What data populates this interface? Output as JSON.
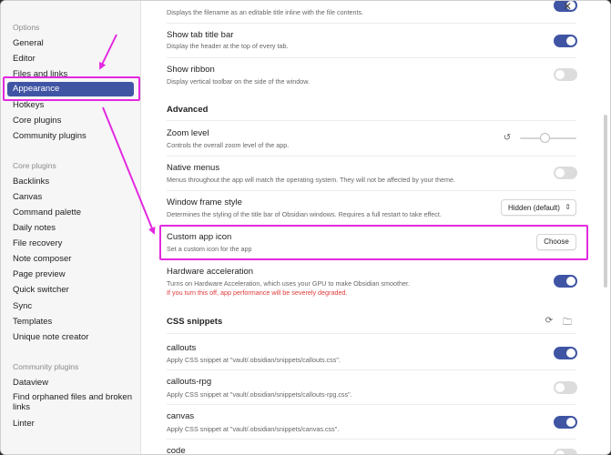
{
  "sidebar": {
    "options_title": "Options",
    "options_items": [
      "General",
      "Editor",
      "Files and links",
      "Appearance",
      "Hotkeys",
      "Core plugins",
      "Community plugins"
    ],
    "core_title": "Core plugins",
    "core_items": [
      "Backlinks",
      "Canvas",
      "Command palette",
      "Daily notes",
      "File recovery",
      "Note composer",
      "Page preview",
      "Quick switcher",
      "Sync",
      "Templates",
      "Unique note creator"
    ],
    "community_title": "Community plugins",
    "community_items": [
      "Dataview",
      "Find orphaned files and broken links",
      "Linter"
    ]
  },
  "settings": {
    "inline_title_desc": "Displays the filename as an editable title inline with the file contents.",
    "tab_title_bar": {
      "name": "Show tab title bar",
      "desc": "Display the header at the top of every tab.",
      "enabled": true
    },
    "ribbon": {
      "name": "Show ribbon",
      "desc": "Display vertical toolbar on the side of the window.",
      "enabled": false
    },
    "advanced_heading": "Advanced",
    "zoom": {
      "name": "Zoom level",
      "desc": "Controls the overall zoom level of the app.",
      "level": 0.45
    },
    "native_menus": {
      "name": "Native menus",
      "desc": "Menus throughout the app will match the operating system. They will not be affected by your theme.",
      "enabled": false
    },
    "frame_style": {
      "name": "Window frame style",
      "desc": "Determines the styling of the title bar of Obsidian windows. Requires a full restart to take effect.",
      "value": "Hidden (default)"
    },
    "app_icon": {
      "name": "Custom app icon",
      "desc": "Set a custom icon for the app",
      "button": "Choose"
    },
    "hw_accel": {
      "name": "Hardware acceleration",
      "desc": "Turns on Hardware Acceleration, which uses your GPU to make Obsidian smoother.",
      "warning": "If you turn this off, app performance will be severely degraded.",
      "enabled": true
    },
    "css_heading": "CSS snippets",
    "snippets": [
      {
        "name": "callouts",
        "desc": "Apply CSS snippet at \"vault/.obsidian/snippets/callouts.css\".",
        "enabled": true
      },
      {
        "name": "callouts-rpg",
        "desc": "Apply CSS snippet at \"vault/.obsidian/snippets/callouts-rpg.css\".",
        "enabled": false
      },
      {
        "name": "canvas",
        "desc": "Apply CSS snippet at \"vault/.obsidian/snippets/canvas.css\".",
        "enabled": true
      },
      {
        "name": "code",
        "desc": "",
        "enabled": false
      }
    ]
  },
  "colors": {
    "accent": "#3f55a4",
    "annotation": "#e329e0",
    "warning": "#e03a3a"
  },
  "icons": {
    "close": "close-icon",
    "reset": "reset-icon",
    "reload": "reload-icon",
    "folder": "folder-icon",
    "chevron": "chevron-updown-icon"
  }
}
